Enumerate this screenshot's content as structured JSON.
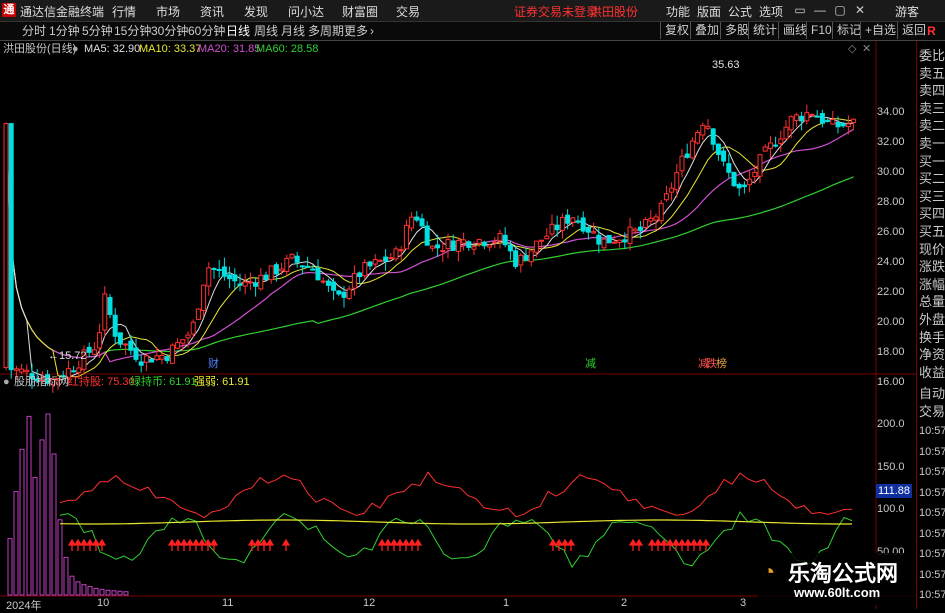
{
  "app": {
    "logo": "通",
    "title": "通达信金融终端",
    "menu": [
      "行情",
      "市场",
      "资讯",
      "发现",
      "问小达",
      "财富圈",
      "交易"
    ],
    "notice": "证券交易未登录",
    "stock": "洪田股份",
    "right_menu": [
      "功能",
      "版面",
      "公式",
      "选项"
    ],
    "user": "游客",
    "window_buttons": [
      "▭",
      "—",
      "▢",
      "✕"
    ]
  },
  "toolbar": {
    "periods": [
      "分时",
      "1分钟",
      "5分钟",
      "15分钟",
      "30分钟",
      "60分钟",
      "日线",
      "周线",
      "月线",
      "多周期",
      "更多"
    ],
    "selected": "日线",
    "right_items": [
      "复权",
      "叠加",
      "多股",
      "统计",
      "画线",
      "F10",
      "标记",
      "+自选",
      "返回"
    ]
  },
  "main_chart": {
    "header_name": "洪田股份(日线)",
    "ma": [
      {
        "label": "MA5: 32.90",
        "color": "#e0e0e0"
      },
      {
        "label": "MA10: 33.37",
        "color": "#e8e830"
      },
      {
        "label": "MA20: 31.85",
        "color": "#d050d0"
      },
      {
        "label": "MA60: 28.58",
        "color": "#30d030"
      }
    ],
    "price_axis": [
      "34.00",
      "32.00",
      "30.00",
      "28.00",
      "26.00",
      "24.00",
      "22.00",
      "20.00",
      "18.00",
      "16.00"
    ],
    "high_label": "35.63",
    "low_label": "15.72",
    "markers": [
      {
        "text": "财",
        "color": "#5080ff"
      },
      {
        "text": "减",
        "color": "#30d030"
      },
      {
        "text": "减",
        "color": "#ff5050"
      },
      {
        "text": "跌",
        "color": "#ff5050"
      },
      {
        "text": "榜",
        "color": "#e8a040"
      }
    ]
  },
  "indicator": {
    "name": "股朋指标网",
    "lines": [
      {
        "label": "红持股: 75.30",
        "color": "#ff3030"
      },
      {
        "label": "绿持币: 61.91",
        "color": "#30d030"
      },
      {
        "label": "强弱: 61.91",
        "color": "#e8e830"
      }
    ],
    "axis": [
      "200.0",
      "150.0",
      "100.0",
      "50.00"
    ],
    "current_value": "111.88"
  },
  "x_axis": [
    "2024年",
    "10",
    "11",
    "12",
    "1",
    "2",
    "3"
  ],
  "right_panel": {
    "items": [
      "委比",
      "卖五",
      "卖四",
      "卖三",
      "卖二",
      "卖一",
      "买一",
      "买二",
      "买三",
      "买四",
      "买五",
      "现价",
      "涨跌",
      "涨幅",
      "总量",
      "外盘",
      "换手",
      "净资",
      "收益"
    ],
    "auto_trade": [
      "自动",
      "交易"
    ],
    "times": [
      "10:57",
      "10:57",
      "10:57",
      "10:57",
      "10:57",
      "10:57",
      "10:57",
      "10:57",
      "10:57"
    ]
  },
  "watermark": {
    "title": "乐淘公式网",
    "url": "www.60lt.com"
  },
  "colors": {
    "up": "#ff3030",
    "down": "#00e0e0",
    "ma60": "#30d030",
    "ma20": "#d050d0",
    "ma10": "#e8e830",
    "ma5": "#e0e0e0",
    "frame": "#7a0000"
  }
}
